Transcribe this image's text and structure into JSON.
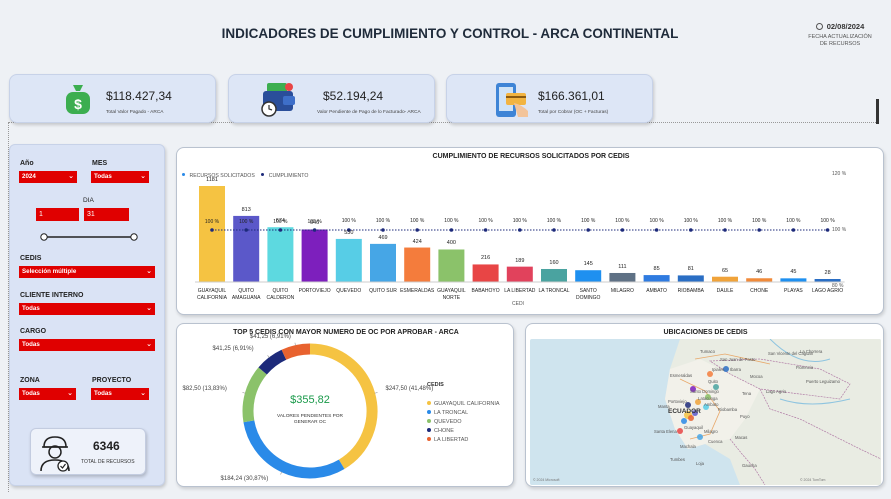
{
  "header": {
    "title": "INDICADORES DE CUMPLIMIENTO Y CONTROL - ARCA CONTINENTAL",
    "update_date": "02/08/2024",
    "update_label_1": "FECHA ACTUALIZACIÓN",
    "update_label_2": "DE RECURSOS"
  },
  "kpis": [
    {
      "value": "$118.427,34",
      "label": "Total Valor Pagado - ARCA",
      "icon": "money-bag-icon"
    },
    {
      "value": "$52.194,24",
      "label": "Valor Pendiente de Pago de lo Facturado- ARCA",
      "icon": "wallet-clock-icon"
    },
    {
      "value": "$166.361,01",
      "label": "Total por Cobrar (OC + Facturas)",
      "icon": "mobile-payment-icon"
    }
  ],
  "filters": {
    "year_label": "Año",
    "year_value": "2024",
    "month_label": "MES",
    "month_value": "Todas",
    "day_label": "DIA",
    "day_from": "1",
    "day_to": "31",
    "day_range": [
      0,
      1
    ],
    "cedis_label": "CEDIS",
    "cedis_value": "Selección múltiple",
    "client_label": "CLIENTE INTERNO",
    "client_value": "Todas",
    "cargo_label": "CARGO",
    "cargo_value": "Todas",
    "zona_label": "ZONA",
    "zona_value": "Todas",
    "proyecto_label": "PROYECTO",
    "proyecto_value": "Todas"
  },
  "resources": {
    "value": "6346",
    "label": "TOTAL DE RECURSOS"
  },
  "bar_chart": {
    "title": "CUMPLIMIENTO DE RECURSOS SOLICITADOS POR CEDIS",
    "legend_1": "RECURSOS SOLICITADOS",
    "legend_2": "CUMPLIMIENTO",
    "xlabel": "CEDI",
    "right_axis": [
      "120 %",
      "100 %",
      "80 %"
    ]
  },
  "chart_data": [
    {
      "type": "bar",
      "title": "CUMPLIMIENTO DE RECURSOS SOLICITADOS POR CEDIS",
      "xlabel": "CEDI",
      "categories": [
        "GUAYAQUIL CALIFORNIA",
        "QUITO AMAGUANA",
        "QUITO CALDERON",
        "PORTOVIEJO",
        "QUEVEDO",
        "QUITO SUR",
        "ESMERALDAS",
        "GUAYAQUIL NORTE",
        "BABAHOYO",
        "LA LIBERTAD",
        "LA TRONCAL",
        "SANTO DOMINGO",
        "MILAGRO",
        "AMBATO",
        "RIOBAMBA",
        "DAULE",
        "CHONE",
        "PLAYAS",
        "LAGO AGRIO"
      ],
      "series": [
        {
          "name": "RECURSOS SOLICITADOS",
          "values": [
            1181,
            813,
            674,
            646,
            530,
            469,
            424,
            400,
            216,
            189,
            160,
            145,
            111,
            85,
            81,
            65,
            46,
            45,
            28
          ]
        },
        {
          "name": "CUMPLIMIENTO",
          "values": [
            100,
            100,
            100,
            100,
            100,
            100,
            100,
            100,
            100,
            100,
            100,
            100,
            100,
            100,
            100,
            100,
            100,
            100,
            100
          ],
          "labels": [
            "100 %",
            "100 %",
            "100 %",
            "100 %",
            "100 %",
            "100 %",
            "100 %",
            "100 %",
            "100 %",
            "100 %",
            "100 %",
            "100 %",
            "100 %",
            "100 %",
            "100 %",
            "100 %",
            "100 %",
            "100 %",
            "100 %"
          ]
        }
      ],
      "bar_labels": [
        "1181",
        "813",
        "674",
        "646",
        "530",
        "469",
        "424",
        "400",
        "216",
        "189",
        "160",
        "145",
        "111",
        "85",
        "81",
        "65",
        "46",
        "45",
        "28"
      ],
      "colors": [
        "#f5c342",
        "#5b58c9",
        "#5dd9e0",
        "#7d1fbd",
        "#57cde6",
        "#46a6e6",
        "#f47c3c",
        "#8bc26a",
        "#e84545",
        "#e1425c",
        "#4aa3a0",
        "#1e90f0",
        "#5f7185",
        "#2f7be0",
        "#2a6ec4",
        "#f0a33a",
        "#f08a3a",
        "#1e90f0",
        "#2a6ec4"
      ],
      "y2_ticks": [
        "120 %",
        "100 %",
        "80 %"
      ]
    },
    {
      "type": "pie",
      "title": "TOP 5 CEDIS CON MAYOR NUMERO DE OC POR APROBAR - ARCA",
      "center_value": "$355,82",
      "center_label": "VALORES PENDIENTES POR GENERAR OC",
      "legend_title": "CEDIS",
      "slices": [
        {
          "name": "GUAYAQUIL CALIFORNIA",
          "value": 247.5,
          "label": "$247,50 (41,48%)",
          "color": "#f5c342"
        },
        {
          "name": "LA TRONCAL",
          "value": 184.24,
          "label": "$184,24 (30,87%)",
          "color": "#2a8ae8"
        },
        {
          "name": "QUEVEDO",
          "value": 82.5,
          "label": "$82,50 (13,83%)",
          "color": "#8bc26a"
        },
        {
          "name": "CHONE",
          "value": 41.25,
          "label": "$41,25 (6,91%)",
          "color": "#1d2a7a"
        },
        {
          "name": "LA LIBERTAD",
          "value": 41.25,
          "label": "$41,25 (6,91%)",
          "color": "#e8622f"
        }
      ]
    }
  ],
  "map": {
    "title": "UBICACIONES DE CEDIS",
    "country_label": "ECUADOR",
    "cities": [
      "Tumaco",
      "San Juan de Pasto",
      "Ipiales",
      "Ibarra",
      "Esmeraldas",
      "Quito",
      "Santo Domingo",
      "Latacunga",
      "Ambato",
      "Riobamba",
      "Guayaquil",
      "Cuenca",
      "Machala",
      "Loja",
      "Tena",
      "Puyo",
      "Macas",
      "La Chorrera",
      "Puerto Leguizamo",
      "San Vicente del Caguan",
      "Florencia",
      "Mocoa",
      "Lago Agrio",
      "Manta",
      "Portoviejo",
      "Santa Elena",
      "Milagro",
      "Tumbes",
      "Gaucha"
    ],
    "footer_left": "© 2024 Microsoft",
    "footer_right": "© 2024 TomTom"
  }
}
